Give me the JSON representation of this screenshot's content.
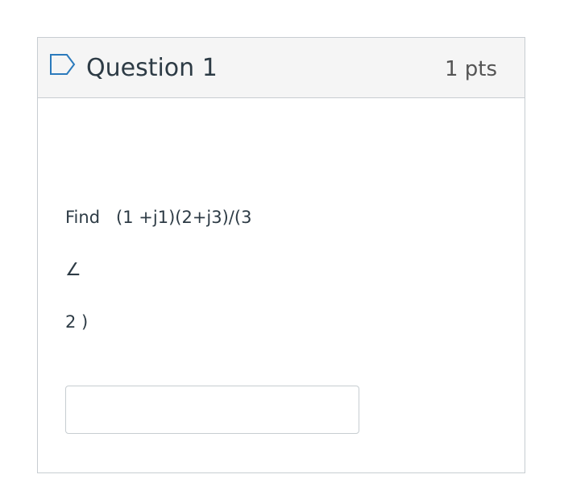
{
  "question": {
    "title": "Question 1",
    "points": "1 pts",
    "flag_icon": "flag-outline-icon",
    "body_lines": [
      "Find   (1 +j1)(2+j3)/(3",
      "∠",
      "2 )"
    ],
    "answer": {
      "value": "",
      "placeholder": ""
    }
  },
  "colors": {
    "header_background": "#f5f5f5",
    "border": "#c7cdd1",
    "text": "#2d3b45",
    "points_text": "#555555"
  }
}
